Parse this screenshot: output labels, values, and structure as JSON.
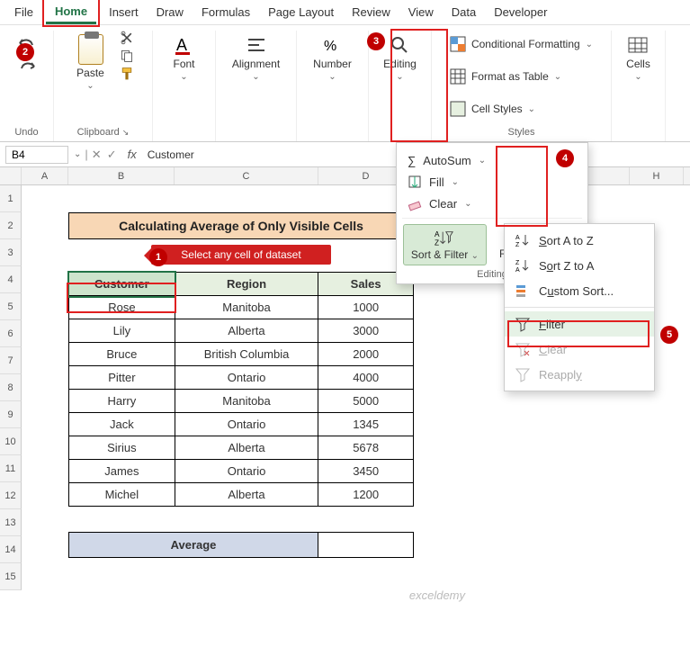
{
  "menu": {
    "file": "File",
    "home": "Home",
    "insert": "Insert",
    "draw": "Draw",
    "formulas": "Formulas",
    "page_layout": "Page Layout",
    "review": "Review",
    "view": "View",
    "data": "Data",
    "developer": "Developer"
  },
  "ribbon": {
    "undo": "Undo",
    "paste": "Paste",
    "clipboard": "Clipboard",
    "font": "Font",
    "alignment": "Alignment",
    "number": "Number",
    "editing": "Editing",
    "cond_fmt": "Conditional Formatting",
    "fmt_table": "Format as Table",
    "cell_styles": "Cell Styles",
    "styles": "Styles",
    "cells": "Cells"
  },
  "formula_bar": {
    "name": "B4",
    "value": "Customer"
  },
  "columns": [
    "A",
    "B",
    "C",
    "D",
    "H"
  ],
  "title": "Calculating Average of Only Visible Cells",
  "tooltip": "Select any cell of dataset",
  "headers": {
    "customer": "Customer",
    "region": "Region",
    "sales": "Sales"
  },
  "rows": [
    {
      "c": "Rose",
      "r": "Manitoba",
      "s": "1000"
    },
    {
      "c": "Lily",
      "r": "Alberta",
      "s": "3000"
    },
    {
      "c": "Bruce",
      "r": "British Columbia",
      "s": "2000"
    },
    {
      "c": "Pitter",
      "r": "Ontario",
      "s": "4000"
    },
    {
      "c": "Harry",
      "r": "Manitoba",
      "s": "5000"
    },
    {
      "c": "Jack",
      "r": "Ontario",
      "s": "1345"
    },
    {
      "c": "Sirius",
      "r": "Alberta",
      "s": "5678"
    },
    {
      "c": "James",
      "r": "Ontario",
      "s": "3450"
    },
    {
      "c": "Michel",
      "r": "Alberta",
      "s": "1200"
    }
  ],
  "average_label": "Average",
  "edit_menu": {
    "autosum": "AutoSum",
    "fill": "Fill",
    "clear": "Clear",
    "sort_filter": "Sort & Filter",
    "find_select": "Find & Select",
    "group": "Editing"
  },
  "sf_menu": {
    "sort_az": "Sort A to Z",
    "sort_za": "Sort Z to A",
    "custom": "Custom Sort...",
    "filter": "Filter",
    "clear": "Clear",
    "reapply": "Reapply"
  },
  "badges": {
    "b1": "1",
    "b2": "2",
    "b3": "3",
    "b4": "4",
    "b5": "5"
  },
  "watermark": "exceldemy",
  "row_nums": [
    "1",
    "2",
    "3",
    "4",
    "5",
    "6",
    "7",
    "8",
    "9",
    "10",
    "11",
    "12",
    "13",
    "14",
    "15"
  ]
}
